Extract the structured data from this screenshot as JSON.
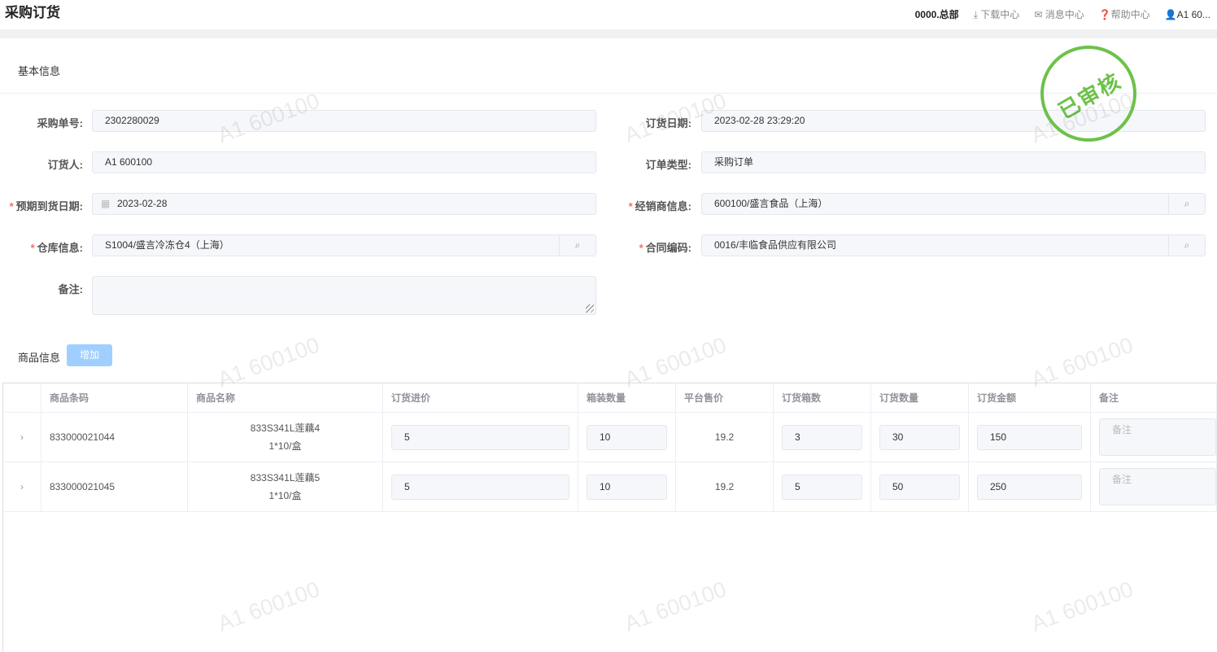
{
  "header": {
    "title": "采购订货",
    "org": "0000.总部",
    "download": "下载中心",
    "messages": "消息中心",
    "help": "帮助中心",
    "user": "A1 60..."
  },
  "basic": {
    "section_title": "基本信息",
    "order_no_label": "采购单号:",
    "order_no": "2302280029",
    "order_date_label": "订货日期:",
    "order_date": "2023-02-28 23:29:20",
    "orderer_label": "订货人:",
    "orderer": "A1 600100",
    "order_type_label": "订单类型:",
    "order_type": "采购订单",
    "expected_date_label": "预期到货日期:",
    "expected_date": "2023-02-28",
    "dealer_label": "经销商信息:",
    "dealer": "600100/盛言食品（上海）",
    "warehouse_label": "仓库信息:",
    "warehouse": "S1004/盛言冷冻仓4（上海）",
    "contract_label": "合同编码:",
    "contract": "0016/丰临食品供应有限公司",
    "remark_label": "备注:",
    "remark": ""
  },
  "stamp": "已审核",
  "watermark": "A1 600100",
  "products": {
    "section_title": "商品信息",
    "add_label": "增加",
    "columns": [
      "商品条码",
      "商品名称",
      "订货进价",
      "箱装数量",
      "平台售价",
      "订货箱数",
      "订货数量",
      "订货金额",
      "备注"
    ],
    "rows": [
      {
        "barcode": "833000021044",
        "name": "833S341L莲藕4",
        "spec": "1*10/盒",
        "price": "5",
        "box_qty": "10",
        "platform_price": "19.2",
        "boxes": "3",
        "qty": "30",
        "amount": "150",
        "remark_placeholder": "备注"
      },
      {
        "barcode": "833000021045",
        "name": "833S341L莲藕5",
        "spec": "1*10/盒",
        "price": "5",
        "box_qty": "10",
        "platform_price": "19.2",
        "boxes": "5",
        "qty": "50",
        "amount": "250",
        "remark_placeholder": "备注"
      }
    ]
  }
}
